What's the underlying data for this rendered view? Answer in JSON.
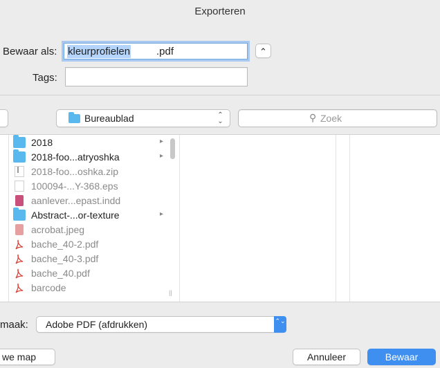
{
  "window": {
    "title": "Exporteren"
  },
  "save_as": {
    "label": "Bewaar als:",
    "name_selected": "kleurprofielen",
    "name_ext": ".pdf"
  },
  "tags": {
    "label": "Tags:",
    "value": ""
  },
  "expand_button": {
    "glyph": "⌃"
  },
  "location": {
    "value": "Bureaublad",
    "glyph": "⌃⌄"
  },
  "search": {
    "placeholder": "Zoek"
  },
  "files": [
    {
      "name": "2018",
      "kind": "folder",
      "has_children": true,
      "dim": false
    },
    {
      "name": "2018-foo...atryoshka",
      "kind": "folder",
      "has_children": true,
      "dim": false
    },
    {
      "name": "2018-foo...oshka.zip",
      "kind": "zip",
      "has_children": false,
      "dim": true
    },
    {
      "name": "100094-...Y-368.eps",
      "kind": "doc",
      "has_children": false,
      "dim": true
    },
    {
      "name": "aanlever...epast.indd",
      "kind": "indd",
      "has_children": false,
      "dim": true
    },
    {
      "name": "Abstract-...or-texture",
      "kind": "folder",
      "has_children": true,
      "dim": false
    },
    {
      "name": "acrobat.jpeg",
      "kind": "jpeg",
      "has_children": false,
      "dim": true
    },
    {
      "name": "bache_40-2.pdf",
      "kind": "pdf",
      "has_children": false,
      "dim": true
    },
    {
      "name": "bache_40-3.pdf",
      "kind": "pdf",
      "has_children": false,
      "dim": true
    },
    {
      "name": "bache_40.pdf",
      "kind": "pdf",
      "has_children": false,
      "dim": true
    },
    {
      "name": "barcode",
      "kind": "pdf",
      "has_children": false,
      "dim": true
    }
  ],
  "format": {
    "label": "maak:",
    "value": "Adobe PDF (afdrukken)"
  },
  "buttons": {
    "new_folder": "we map",
    "cancel": "Annuleer",
    "save": "Bewaar"
  },
  "colors": {
    "accent": "#3f8ff0",
    "folder": "#59b9ee",
    "selection": "#b4d4fb"
  }
}
